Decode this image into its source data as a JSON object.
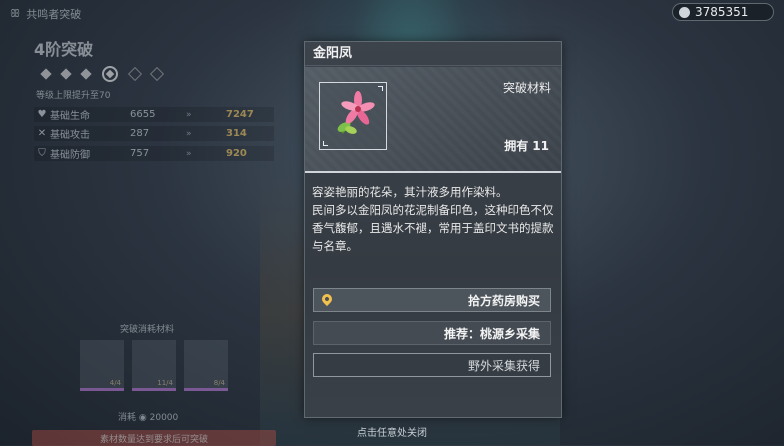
{
  "header": {
    "title": "共鸣者突破"
  },
  "coins": {
    "amount": "3785351",
    "icon": "coin-icon"
  },
  "breakthrough": {
    "title": "4阶突破",
    "level_up": "等级上限提升至70",
    "stats": [
      {
        "icon": "hp-icon",
        "glyph": "♥",
        "name": "基础生命",
        "from": "6655",
        "to": "7247"
      },
      {
        "icon": "atk-icon",
        "glyph": "✕",
        "name": "基础攻击",
        "from": "287",
        "to": "314"
      },
      {
        "icon": "def-icon",
        "glyph": "⛉",
        "name": "基础防御",
        "from": "757",
        "to": "920"
      }
    ],
    "materials_label": "突破消耗材料",
    "materials": [
      {
        "name": "material-1",
        "count": "4/4"
      },
      {
        "name": "material-2",
        "count": "11/4"
      },
      {
        "name": "material-3",
        "count": "8/4"
      }
    ],
    "cost_label": "消耗",
    "cost_value": "20000",
    "warning": "素材数量达到要求后可突破"
  },
  "popup": {
    "title": "金阳凤",
    "category": "突破材料",
    "owned_label": "拥有",
    "owned_count": "11",
    "description": [
      "容姿艳丽的花朵，其汁液多用作染料。",
      "民间多以金阳凤的花泥制备印色，这种印色不仅香气馥郁，且遇水不褪，常用于盖印文书的提款与名章。"
    ],
    "buttons": {
      "shop": "拾方药房购买",
      "recommend": "推荐：桃源乡采集",
      "wild": "野外采集获得"
    },
    "colors": {
      "pin": "#f2c14e",
      "stat_up": "#f1c55b"
    }
  },
  "footer": {
    "close_hint": "点击任意处关闭"
  }
}
